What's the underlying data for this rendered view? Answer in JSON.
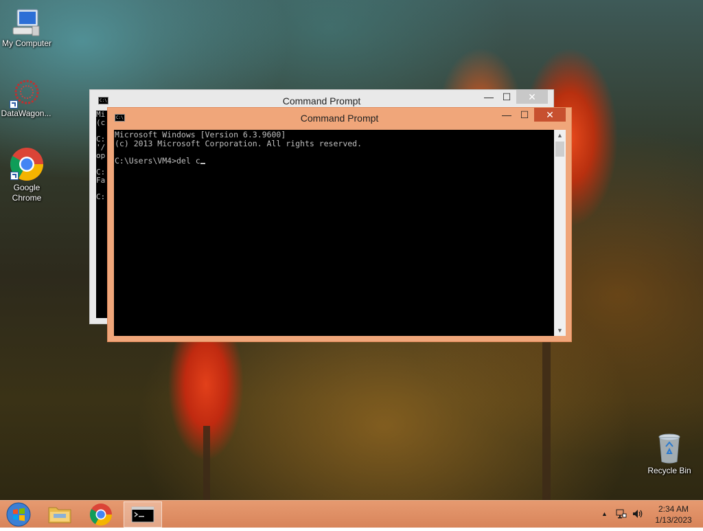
{
  "desktop": {
    "icons": [
      {
        "label": "My Computer",
        "icon": "computer-icon"
      },
      {
        "label": "DataWagon...",
        "icon": "datawagon-icon"
      },
      {
        "label": "Google\nChrome",
        "icon": "chrome-icon"
      },
      {
        "label": "Recycle Bin",
        "icon": "recycle-bin-icon"
      }
    ]
  },
  "windows": {
    "back": {
      "title": "Command Prompt",
      "console_visible": "Mi\n(c\n\nC:\n'/\nop\n\nC:\nFa\n\nC:"
    },
    "front": {
      "title": "Command Prompt",
      "console_lines": [
        "Microsoft Windows [Version 6.3.9600]",
        "(c) 2013 Microsoft Corporation. All rights reserved.",
        "",
        "C:\\Users\\VM4>del c"
      ]
    },
    "controls": {
      "minimize": "—",
      "maximize": "☐",
      "close": "✕"
    }
  },
  "taskbar": {
    "items": [
      "start-button",
      "file-explorer",
      "google-chrome",
      "command-prompt"
    ],
    "tray": {
      "time": "2:34 AM",
      "date": "1/13/2023",
      "show_hidden_glyph": "▲"
    }
  },
  "colors": {
    "front_window_frame": "#f0a67a",
    "close_button": "#c7502f",
    "taskbar": "#e0906a"
  }
}
